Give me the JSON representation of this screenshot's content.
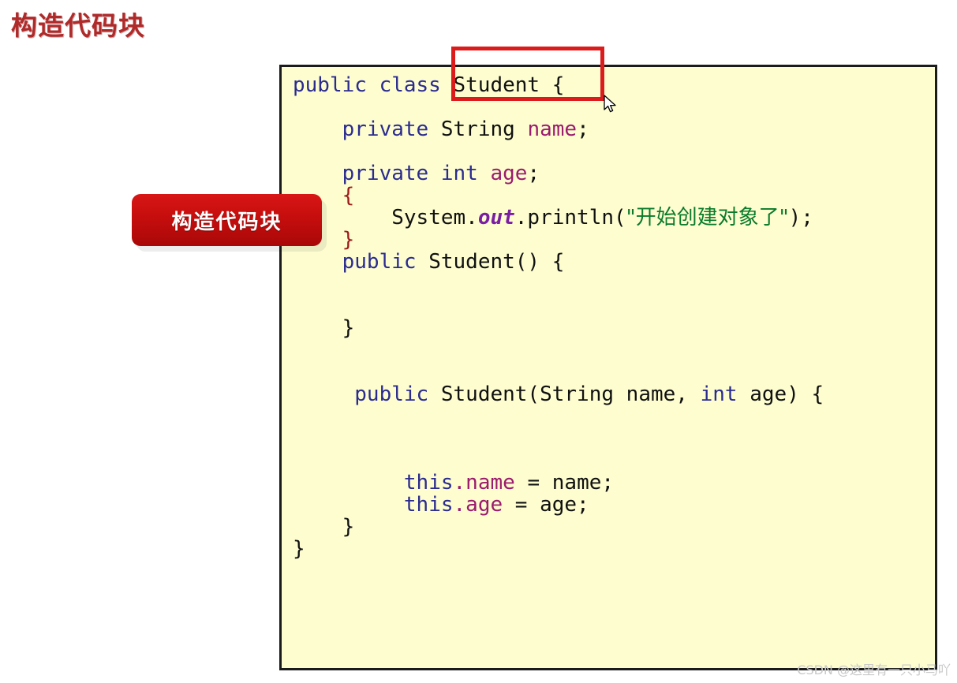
{
  "slide": {
    "title": "构造代码块",
    "title_color": "#b02a2a"
  },
  "callout": {
    "label": "构造代码块",
    "background_color": "#c60d0d",
    "text_color": "#ffffff"
  },
  "highlight": {
    "target_text": "Student {",
    "border_color": "#dc1c1c"
  },
  "cursor": {
    "icon": "arrow-pointer-icon"
  },
  "watermark": {
    "text": "CSDN @这里有一只小马吖"
  },
  "code_panel": {
    "background_color": "#fdfdd0",
    "border_color": "#1b1b1b",
    "language": "java",
    "lines": [
      {
        "indent": 0,
        "tokens": [
          {
            "t": "public class ",
            "c": "kw"
          },
          {
            "t": "Student {",
            "c": "plain"
          }
        ]
      },
      {
        "indent": 0,
        "tokens": []
      },
      {
        "indent": 1,
        "tokens": [
          {
            "t": "private ",
            "c": "kw"
          },
          {
            "t": "String ",
            "c": "plain"
          },
          {
            "t": "name",
            "c": "field"
          },
          {
            "t": ";",
            "c": "plain"
          }
        ]
      },
      {
        "indent": 0,
        "tokens": []
      },
      {
        "indent": 1,
        "tokens": [
          {
            "t": "private int ",
            "c": "kw"
          },
          {
            "t": "age",
            "c": "field"
          },
          {
            "t": ";",
            "c": "plain"
          }
        ]
      },
      {
        "indent": 1,
        "tokens": [
          {
            "t": "{",
            "c": "brace"
          }
        ]
      },
      {
        "indent": 2,
        "tokens": [
          {
            "t": "System.",
            "c": "plain"
          },
          {
            "t": "out",
            "c": "static"
          },
          {
            "t": ".println(",
            "c": "plain"
          },
          {
            "t": "\"开始创建对象了\"",
            "c": "string"
          },
          {
            "t": ");",
            "c": "plain"
          }
        ]
      },
      {
        "indent": 1,
        "tokens": [
          {
            "t": "}",
            "c": "brace"
          }
        ]
      },
      {
        "indent": 1,
        "tokens": [
          {
            "t": "public ",
            "c": "kw"
          },
          {
            "t": "Student() {",
            "c": "plain"
          }
        ]
      },
      {
        "indent": 0,
        "tokens": []
      },
      {
        "indent": 0,
        "tokens": []
      },
      {
        "indent": 1,
        "tokens": [
          {
            "t": "}",
            "c": "plain"
          }
        ]
      },
      {
        "indent": 0,
        "tokens": []
      },
      {
        "indent": 0,
        "tokens": []
      },
      {
        "indent": 1,
        "tokens": [
          {
            "t": " public ",
            "c": "kw"
          },
          {
            "t": "Student(String ",
            "c": "plain"
          },
          {
            "t": "name",
            "c": "plain"
          },
          {
            "t": ", ",
            "c": "plain"
          },
          {
            "t": "int ",
            "c": "kw"
          },
          {
            "t": "age) {",
            "c": "plain"
          }
        ]
      },
      {
        "indent": 0,
        "tokens": []
      },
      {
        "indent": 0,
        "tokens": []
      },
      {
        "indent": 0,
        "tokens": []
      },
      {
        "indent": 2,
        "tokens": [
          {
            "t": " this",
            "c": "kw"
          },
          {
            "t": ".name",
            "c": "field"
          },
          {
            "t": " = name;",
            "c": "plain"
          }
        ]
      },
      {
        "indent": 2,
        "tokens": [
          {
            "t": " this",
            "c": "kw"
          },
          {
            "t": ".age",
            "c": "field"
          },
          {
            "t": " = age;",
            "c": "plain"
          }
        ]
      },
      {
        "indent": 1,
        "tokens": [
          {
            "t": "}",
            "c": "plain"
          }
        ]
      },
      {
        "indent": 0,
        "tokens": [
          {
            "t": "}",
            "c": "plain"
          }
        ]
      }
    ]
  }
}
